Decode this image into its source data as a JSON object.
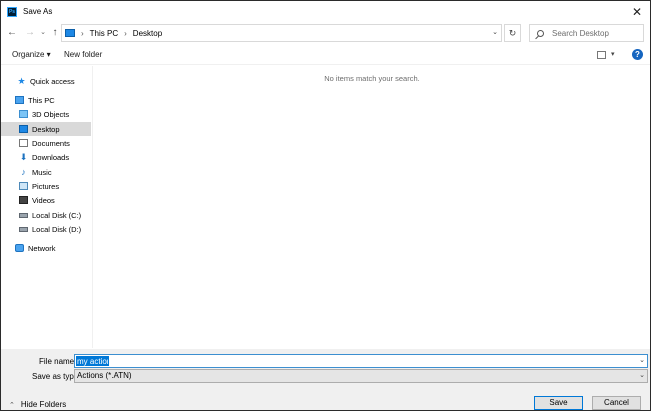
{
  "window": {
    "title": "Save As",
    "app_icon_text": "Ps",
    "close_glyph": "✕"
  },
  "address_bar": {
    "crumbs": [
      "This PC",
      "Desktop"
    ],
    "separator": "›"
  },
  "search": {
    "placeholder": "Search Desktop"
  },
  "toolbar": {
    "organize_label": "Organize ▾",
    "new_folder_label": "New folder",
    "help_label": "?"
  },
  "nav_pane": {
    "items": [
      {
        "label": "Quick access",
        "icon": "quick-access-star-icon"
      },
      {
        "label": "This PC",
        "icon": "this-pc-icon"
      },
      {
        "label": "3D Objects",
        "icon": "3d-objects-icon"
      },
      {
        "label": "Desktop",
        "icon": "desktop-folder-icon",
        "selected": true
      },
      {
        "label": "Documents",
        "icon": "documents-icon"
      },
      {
        "label": "Downloads",
        "icon": "downloads-icon"
      },
      {
        "label": "Music",
        "icon": "music-icon"
      },
      {
        "label": "Pictures",
        "icon": "pictures-icon"
      },
      {
        "label": "Videos",
        "icon": "videos-icon"
      },
      {
        "label": "Local Disk (C:)",
        "icon": "local-disk-icon"
      },
      {
        "label": "Local Disk (D:)",
        "icon": "local-disk-icon"
      },
      {
        "label": "Network",
        "icon": "network-icon"
      }
    ]
  },
  "content": {
    "empty_message": "No items match your search."
  },
  "footer": {
    "file_name_label": "File name:",
    "file_name_value": "my action",
    "save_as_type_label": "Save as type:",
    "save_as_type_value": "Actions (*.ATN)",
    "hide_folders_label": "Hide Folders",
    "save_label": "Save",
    "cancel_label": "Cancel"
  },
  "colors": {
    "selection_blue": "#0078d7",
    "nav_selected": "#d9d9d9",
    "footer_bg": "#f0f0f0"
  }
}
